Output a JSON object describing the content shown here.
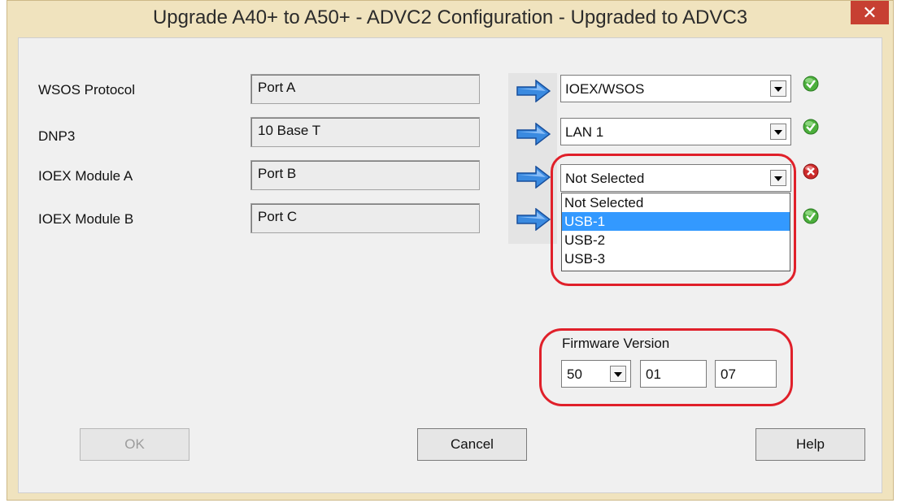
{
  "window": {
    "title": "Upgrade A40+ to A50+ - ADVC2 Configuration - Upgraded to ADVC3",
    "close_glyph": "✕"
  },
  "rows": [
    {
      "label": "WSOS Protocol",
      "source": "Port A",
      "target": "IOEX/WSOS",
      "status": "ok"
    },
    {
      "label": "DNP3",
      "source": "10 Base T",
      "target": "LAN 1",
      "status": "ok"
    },
    {
      "label": "IOEX Module A",
      "source": "Port B",
      "target": "Not Selected",
      "status": "error"
    },
    {
      "label": "IOEX Module B",
      "source": "Port C",
      "target": "",
      "status": "ok"
    }
  ],
  "dropdown_options": [
    "Not Selected",
    "USB-1",
    "USB-2",
    "USB-3"
  ],
  "dropdown_selected": "USB-1",
  "firmware": {
    "label": "Firmware Version",
    "major": "50",
    "minor": "01",
    "patch": "07"
  },
  "buttons": {
    "ok": "OK",
    "cancel": "Cancel",
    "help": "Help"
  },
  "colors": {
    "ok_green": "#4caf3c",
    "error_red": "#cc2b2b",
    "highlight_red": "#e0202a",
    "arrow_blue": "#2f7fd8",
    "selection_blue": "#3399ff"
  }
}
